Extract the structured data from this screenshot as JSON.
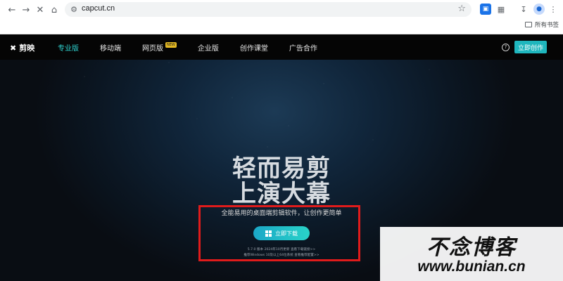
{
  "browser": {
    "url": "capcut.cn",
    "bookmarks_folder_label": "所有书签",
    "icons": [
      "back-icon",
      "forward-icon",
      "stop-icon",
      "home-icon",
      "site-settings-icon",
      "star-icon",
      "screenshot-icon",
      "extensions-icon",
      "download-icon",
      "profile-icon",
      "more-icon",
      "folder-icon"
    ]
  },
  "site_nav": {
    "brand": "剪映",
    "items": [
      {
        "label": "专业版",
        "active": true
      },
      {
        "label": "移动端",
        "active": false
      },
      {
        "label": "网页版",
        "active": false,
        "badge": "NEW"
      },
      {
        "label": "企业版",
        "active": false
      },
      {
        "label": "创作课堂",
        "active": false
      },
      {
        "label": "广告合作",
        "active": false
      }
    ],
    "help_glyph": "?",
    "cta": "立即创作"
  },
  "hero": {
    "headline_line1": "轻而易剪",
    "headline_line2": "上演大幕",
    "subtitle": "全能易用的桌面端剪辑软件，让创作更简单",
    "download_button": "立即下载",
    "version_note": "5.7.0 版本 2024年10月更新 查看下载链接>>",
    "system_note": "推荐Windows 10及以上64位系统 查看推荐配置>>"
  },
  "watermark": {
    "logo_text": "不念博客",
    "domain": "www.bunian.cn"
  },
  "colors": {
    "accent": "#2fd3d0",
    "cta_bg": "#1fb6bd",
    "highlight_border": "#e01b1b",
    "badge": "#e4b923"
  }
}
